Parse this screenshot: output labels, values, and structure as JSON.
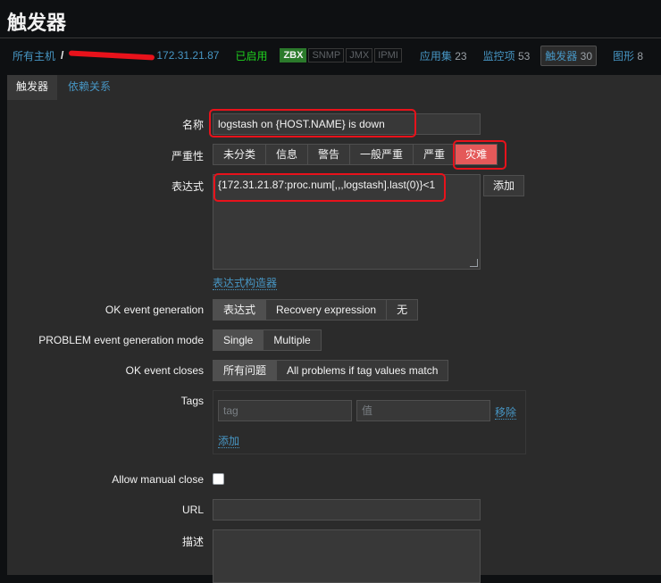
{
  "page_title": "触发器",
  "breadcrumb": {
    "all_hosts": "所有主机",
    "separator": "/",
    "host_visible": "172.31.21.87",
    "status": "已启用",
    "badges": [
      "ZBX",
      "SNMP",
      "JMX",
      "IPMI"
    ],
    "nav": [
      {
        "label": "应用集",
        "count": "23"
      },
      {
        "label": "监控项",
        "count": "53"
      },
      {
        "label": "触发器",
        "count": "30"
      },
      {
        "label": "图形",
        "count": "8"
      }
    ]
  },
  "tabs": {
    "trigger": "触发器",
    "dependencies": "依赖关系"
  },
  "form": {
    "name_label": "名称",
    "name_value": "logstash on {HOST.NAME} is down",
    "severity_label": "严重性",
    "severities": [
      "未分类",
      "信息",
      "警告",
      "一般严重",
      "严重",
      "灾难"
    ],
    "selected_severity": "灾难",
    "expression_label": "表达式",
    "expression_value": "{172.31.21.87:proc.num[,,,logstash].last(0)}<1",
    "add_button": "添加",
    "expression_builder_link": "表达式构造器",
    "ok_event_generation_label": "OK event generation",
    "ok_event_generation_options": [
      "表达式",
      "Recovery expression",
      "无"
    ],
    "problem_mode_label": "PROBLEM event generation mode",
    "problem_mode_options": [
      "Single",
      "Multiple"
    ],
    "ok_event_closes_label": "OK event closes",
    "ok_event_closes_options": [
      "所有问题",
      "All problems if tag values match"
    ],
    "tags_label": "Tags",
    "tag_placeholder": "tag",
    "value_placeholder": "值",
    "remove_link": "移除",
    "add_tag_link": "添加",
    "allow_manual_close_label": "Allow manual close",
    "url_label": "URL",
    "description_label": "描述"
  },
  "colors": {
    "accent": "#4796c4",
    "disaster": "#e45959",
    "enabled": "#1fd11f",
    "highlight": "#e8121b"
  }
}
